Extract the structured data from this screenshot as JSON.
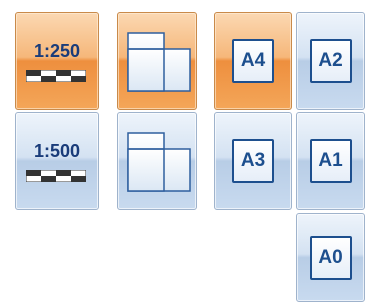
{
  "scales": [
    {
      "label": "1:250",
      "selected": true
    },
    {
      "label": "1:500",
      "selected": false
    }
  ],
  "orientations": [
    {
      "icon": "page-orientation-icon",
      "selected": true
    },
    {
      "icon": "page-orientation-icon",
      "selected": false
    }
  ],
  "paper_sizes": [
    {
      "label": "A4",
      "selected": true
    },
    {
      "label": "A2",
      "selected": false
    },
    {
      "label": "A3",
      "selected": false
    },
    {
      "label": "A1",
      "selected": false
    },
    {
      "label": "A0",
      "selected": false
    }
  ],
  "colors": {
    "selected_accent": "#f29a4a",
    "tile_blue": "#c8daef",
    "icon_text": "#1d4f8e"
  }
}
